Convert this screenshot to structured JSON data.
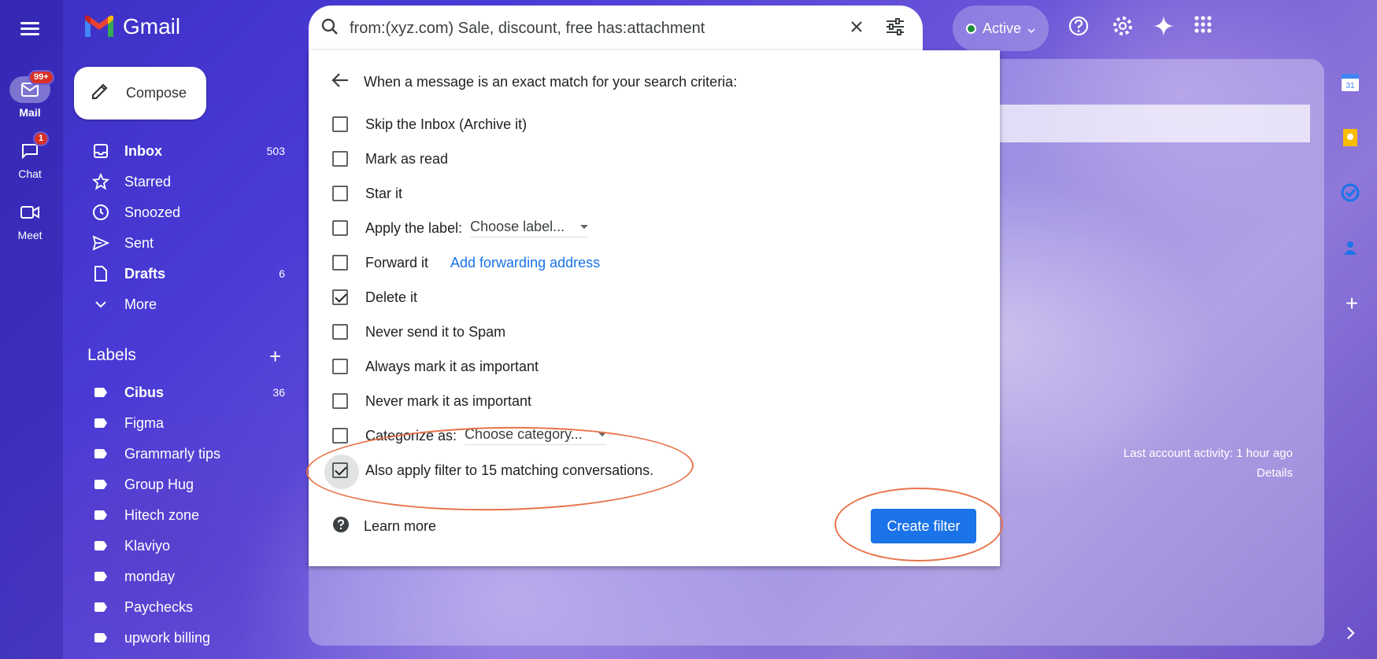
{
  "app": {
    "name": "Gmail"
  },
  "search": {
    "query": "from:(xyz.com) Sale, discount, free has:attachment"
  },
  "status": {
    "label": "Active"
  },
  "rail": {
    "mail": {
      "label": "Mail",
      "badge": "99+"
    },
    "chat": {
      "label": "Chat",
      "badge": "1"
    },
    "meet": {
      "label": "Meet"
    }
  },
  "compose": {
    "label": "Compose"
  },
  "nav": [
    {
      "label": "Inbox",
      "count": "503",
      "bold": true
    },
    {
      "label": "Starred",
      "count": ""
    },
    {
      "label": "Snoozed",
      "count": ""
    },
    {
      "label": "Sent",
      "count": ""
    },
    {
      "label": "Drafts",
      "count": "6",
      "bold": true
    },
    {
      "label": "More",
      "count": ""
    }
  ],
  "labels": {
    "heading": "Labels",
    "items": [
      {
        "label": "Cibus",
        "count": "36",
        "bold": true
      },
      {
        "label": "Figma",
        "count": ""
      },
      {
        "label": "Grammarly tips",
        "count": ""
      },
      {
        "label": "Group Hug",
        "count": ""
      },
      {
        "label": "Hitech zone",
        "count": ""
      },
      {
        "label": "Klaviyo",
        "count": ""
      },
      {
        "label": "monday",
        "count": ""
      },
      {
        "label": "Paychecks",
        "count": ""
      },
      {
        "label": "upwork billing",
        "count": ""
      }
    ]
  },
  "filter": {
    "heading": "When a message is an exact match for your search criteria:",
    "options": [
      {
        "label": "Skip the Inbox (Archive it)",
        "checked": false
      },
      {
        "label": "Mark as read",
        "checked": false
      },
      {
        "label": "Star it",
        "checked": false
      },
      {
        "label": "Apply the label:",
        "checked": false
      },
      {
        "label": "Forward it",
        "checked": false
      },
      {
        "label": "Delete it",
        "checked": true
      },
      {
        "label": "Never send it to Spam",
        "checked": false
      },
      {
        "label": "Always mark it as important",
        "checked": false
      },
      {
        "label": "Never mark it as important",
        "checked": false
      },
      {
        "label": "Categorize as:",
        "checked": false
      },
      {
        "label": "Also apply filter to 15 matching conversations.",
        "checked": true
      }
    ],
    "label_dropdown": "Choose label...",
    "category_dropdown": "Choose category...",
    "forward_link": "Add forwarding address",
    "learn_more": "Learn more",
    "create_button": "Create filter"
  },
  "activity": {
    "text": "Last account activity: 1 hour ago",
    "details": "Details"
  },
  "colors": {
    "primary": "#1a73e8",
    "annotation": "#e8734a",
    "danger_badge": "#d93025"
  }
}
